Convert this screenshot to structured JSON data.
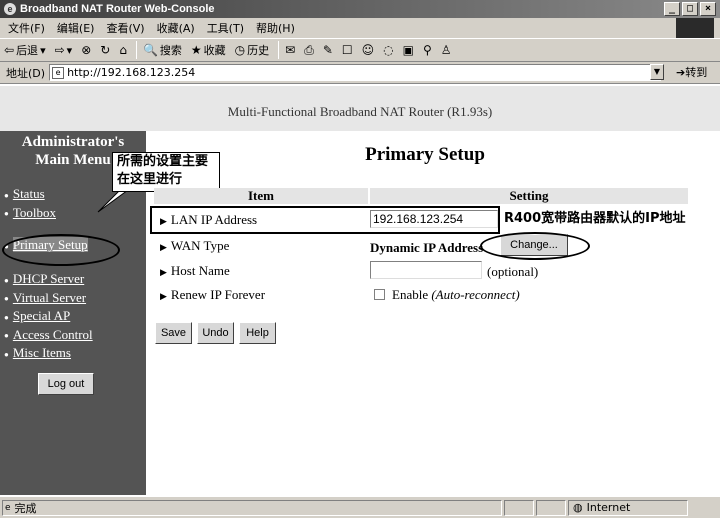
{
  "window": {
    "title": "Broadband NAT Router Web-Console",
    "controls": [
      "_",
      "□",
      "×"
    ]
  },
  "menu": [
    "文件(F)",
    "编辑(E)",
    "查看(V)",
    "收藏(A)",
    "工具(T)",
    "帮助(H)"
  ],
  "toolbar": {
    "back": "后退",
    "search": "搜索",
    "favorites": "收藏",
    "history": "历史"
  },
  "address": {
    "label": "地址(D)",
    "url": "http://192.168.123.254",
    "go": "转到"
  },
  "page": {
    "banner": "Multi-Functional Broadband NAT Router (R1.93s)",
    "sidebar_title_1": "Administrator's",
    "sidebar_title_2": "Main Menu",
    "menu_items": [
      "Status",
      "Toolbox",
      "Primary Setup",
      "DHCP Server",
      "Virtual Server",
      "Special AP",
      "Access Control",
      "Misc Items"
    ],
    "logout": "Log out",
    "heading": "Primary Setup",
    "col_item": "Item",
    "col_setting": "Setting",
    "rows": {
      "lan_label": "LAN IP Address",
      "lan_value": "192.168.123.254",
      "wan_label": "WAN Type",
      "wan_value": "Dynamic IP Address",
      "wan_button": "Change...",
      "host_label": "Host Name",
      "host_value": "",
      "host_hint": "(optional)",
      "renew_label": "Renew IP Forever",
      "renew_check": "Enable",
      "renew_hint": "(Auto-reconnect)"
    },
    "buttons": {
      "save": "Save",
      "undo": "Undo",
      "help": "Help"
    }
  },
  "annotations": {
    "callout": "所需的设置主要在这里进行",
    "lan_note": "R400宽带路由器默认的IP地址"
  },
  "status": {
    "left": "完成",
    "zone": "Internet"
  }
}
